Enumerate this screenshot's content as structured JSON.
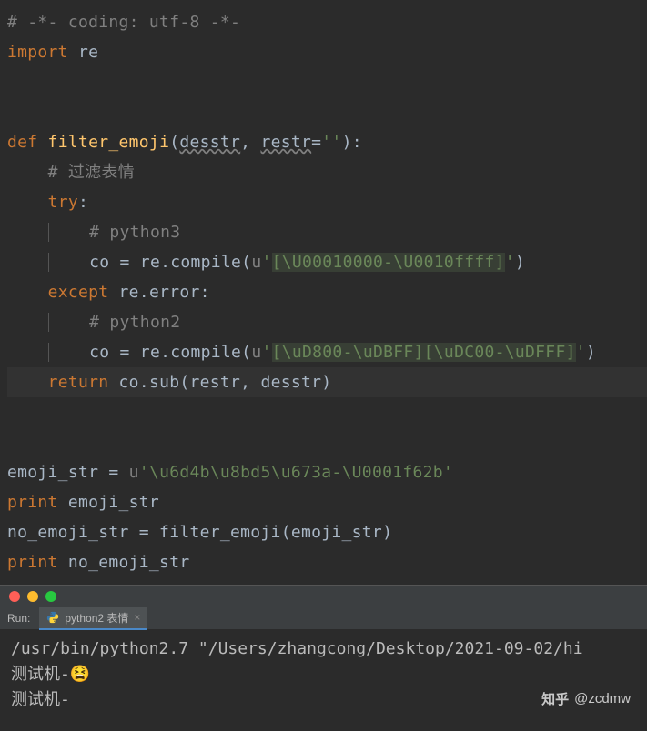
{
  "code": {
    "l1_comment": "# -*- coding: utf-8 -*-",
    "l2_import": "import",
    "l2_mod": " re",
    "l5_def": "def",
    "l5_fn": " filter_emoji",
    "l5_open": "(",
    "l5_p1": "desstr",
    "l5_comma": ", ",
    "l5_p2": "restr",
    "l5_eq": "=",
    "l5_def_str": "''",
    "l5_close": "):",
    "l6_comment": "# 过滤表情",
    "l7_try": "try",
    "l7_colon": ":",
    "l8_comment": "# python3",
    "l9_co": "co = re.compile(",
    "l9_u": "u",
    "l9_q1": "'",
    "l9_str": "[\\U00010000-\\U0010ffff]",
    "l9_q2": "'",
    "l9_end": ")",
    "l10_except": "except",
    "l10_err": " re.error:",
    "l11_comment": "# python2",
    "l12_co": "co = re.compile(",
    "l12_u": "u",
    "l12_q1": "'",
    "l12_str": "[\\uD800-\\uDBFF][\\uDC00-\\uDFFF]",
    "l12_q2": "'",
    "l12_end": ")",
    "l13_return": "return",
    "l13_rest": " co.sub(restr, desstr)",
    "l16_var": "emoji_str = ",
    "l16_u": "u",
    "l16_str": "'\\u6d4b\\u8bd5\\u673a-\\U0001f62b'",
    "l17_print": "print",
    "l17_arg": " emoji_str",
    "l18_assign": "no_emoji_str = filter_emoji(emoji_str)",
    "l19_print": "print",
    "l19_arg": " no_emoji_str"
  },
  "terminal": {
    "run_label": "Run:",
    "tab_label": "python2 表情",
    "line1": "/usr/bin/python2.7 \"/Users/zhangcong/Desktop/2021-09-02/hi",
    "line2": "测试机-😫",
    "line3": "测试机-"
  },
  "watermark": {
    "logo": "知乎",
    "handle": "@zcdmw"
  }
}
